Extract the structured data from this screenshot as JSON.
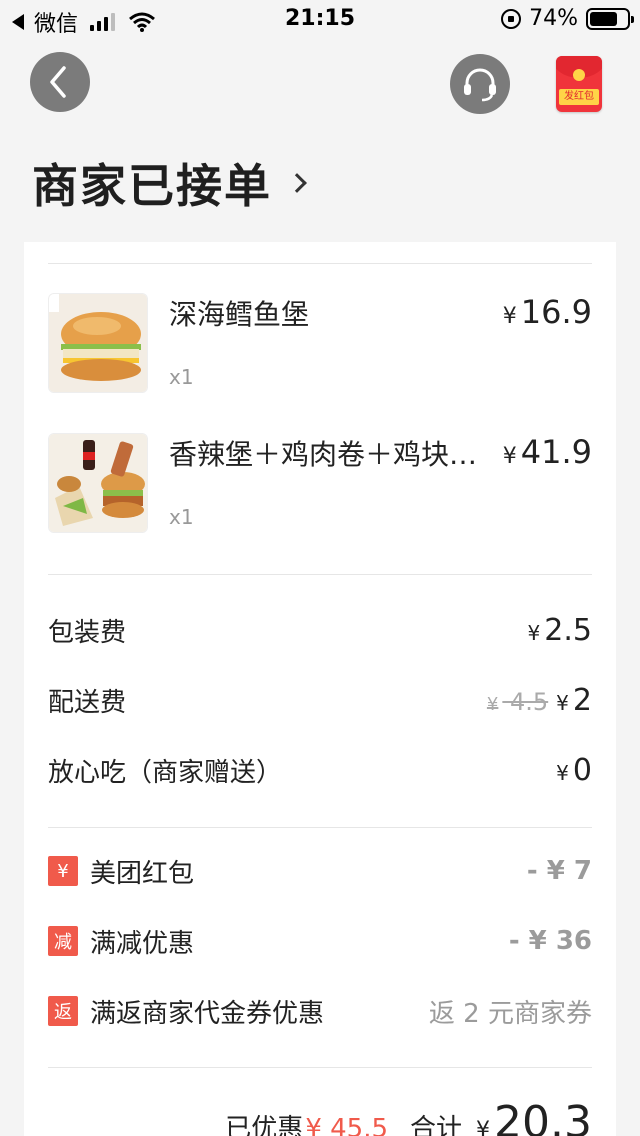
{
  "status_bar": {
    "carrier": "微信",
    "time": "21:15",
    "battery": "74%",
    "battery_level": 0.74
  },
  "nav": {
    "redpack_label": "发红包"
  },
  "header": {
    "title": "商家已接单"
  },
  "items": [
    {
      "name": "深海鳕鱼堡",
      "qty": "x1",
      "currency": "¥",
      "price": "16.9"
    },
    {
      "name": "香辣堡＋鸡肉卷＋鸡块…",
      "qty": "x1",
      "currency": "¥",
      "price": "41.9"
    }
  ],
  "fees": {
    "packaging": {
      "label": "包装费",
      "currency": "¥",
      "value": "2.5"
    },
    "delivery": {
      "label": "配送费",
      "original_currency": "¥",
      "original": "4.5",
      "currency": "¥",
      "value": "2"
    },
    "assurance": {
      "label": "放心吃（商家赠送）",
      "currency": "¥",
      "value": "0"
    }
  },
  "discounts": [
    {
      "badge": "¥",
      "label": "美团红包",
      "value": "- ¥ 7"
    },
    {
      "badge": "减",
      "label": "满减优惠",
      "value": "- ¥ 36"
    },
    {
      "badge": "返",
      "label": "满返商家代金券优惠",
      "value": "返 2 元商家券"
    }
  ],
  "summary": {
    "saved_label": "已优惠",
    "saved_value": "¥ 45.5",
    "total_label": "合计",
    "total_currency": "¥",
    "total_value": "20.3"
  },
  "colors": {
    "accent_red": "#f05a4b",
    "nav_button": "#7b7b7b"
  }
}
